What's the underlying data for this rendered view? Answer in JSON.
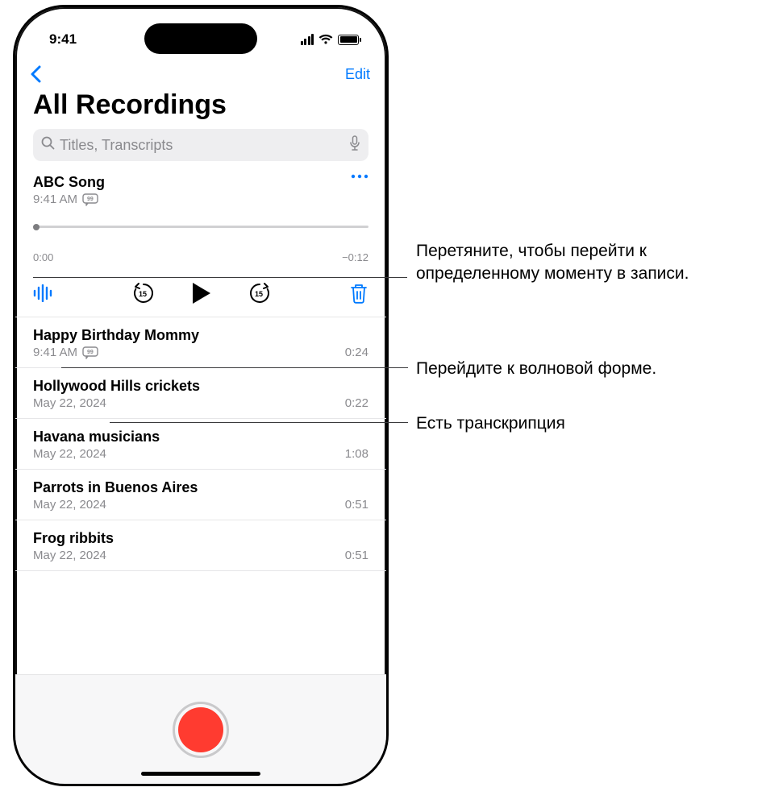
{
  "status": {
    "time": "9:41"
  },
  "nav": {
    "edit": "Edit"
  },
  "title": "All Recordings",
  "search": {
    "placeholder": "Titles, Transcripts"
  },
  "expanded": {
    "title": "ABC Song",
    "subtitle": "9:41 AM",
    "elapsed": "0:00",
    "remaining": "−0:12"
  },
  "recordings": [
    {
      "title": "Happy Birthday Mommy",
      "subtitle": "9:41 AM",
      "duration": "0:24",
      "has_transcript": true
    },
    {
      "title": "Hollywood Hills crickets",
      "subtitle": "May 22, 2024",
      "duration": "0:22",
      "has_transcript": false
    },
    {
      "title": "Havana musicians",
      "subtitle": "May 22, 2024",
      "duration": "1:08",
      "has_transcript": false
    },
    {
      "title": "Parrots in Buenos Aires",
      "subtitle": "May 22, 2024",
      "duration": "0:51",
      "has_transcript": false
    },
    {
      "title": "Frog ribbits",
      "subtitle": "May 22, 2024",
      "duration": "0:51",
      "has_transcript": false
    }
  ],
  "callouts": {
    "scrub": "Перетяните, чтобы перейти к определенному моменту в записи.",
    "waveform": "Перейдите к волновой форме.",
    "transcript": "Есть транскрипция"
  }
}
